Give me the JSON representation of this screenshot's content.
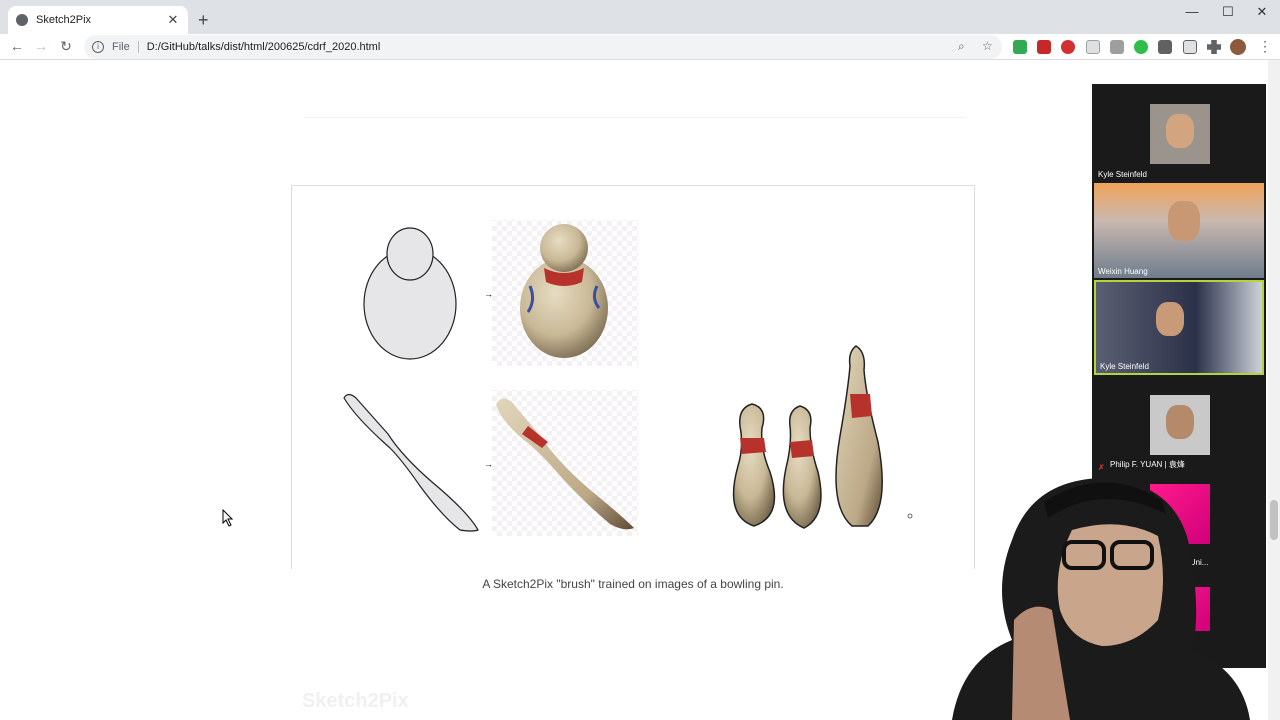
{
  "browser": {
    "tab_title": "Sketch2Pix",
    "tab_close": "✕",
    "new_tab": "+",
    "url_label": "File",
    "url": "D:/GitHub/talks/dist/html/200625/cdrf_2020.html",
    "window_minimize": "—",
    "window_maximize": "☐",
    "window_close": "✕",
    "icons": {
      "back": "←",
      "forward": "→",
      "reload": "↻",
      "zoom": "⌕",
      "star": "☆",
      "kebab": "⋮"
    },
    "extension_colors": [
      "#34a853",
      "#c62828",
      "#d32f2f",
      "#9aa0a6",
      "#757575",
      "#2fbf48",
      "#616161",
      "#5f6368",
      "#5f6368"
    ]
  },
  "page": {
    "caption": "A Sketch2Pix \"brush\" trained on images of a bowling pin.",
    "faded_heading": "Sketch2Pix"
  },
  "zoom_panel": {
    "participants": [
      {
        "name": "Kyle Steinfeld"
      },
      {
        "name": "Weixin Huang"
      },
      {
        "name": "Kyle Steinfeld"
      },
      {
        "name": "Philip F. YUAN | 袁烽"
      },
      {
        "name": "...ongji Uni..."
      },
      {
        "name": ""
      }
    ]
  }
}
